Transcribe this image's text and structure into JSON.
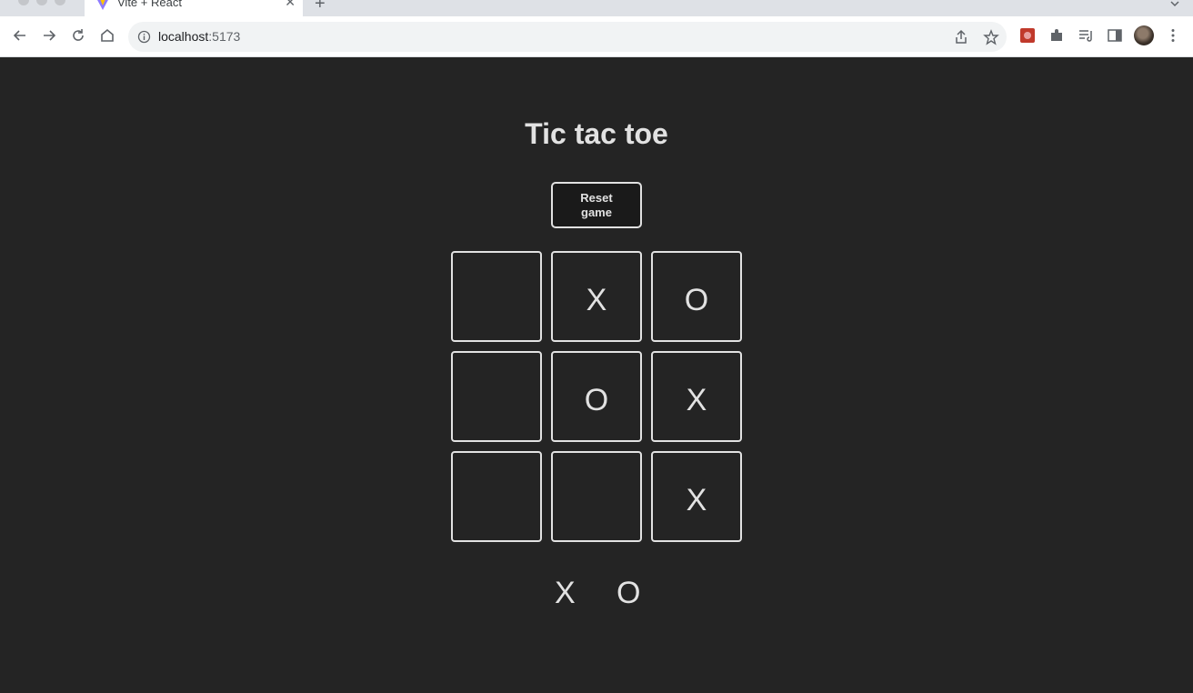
{
  "browser": {
    "tab_title": "Vite + React",
    "url_host": "localhost",
    "url_port": ":5173"
  },
  "game": {
    "title": "Tic tac toe",
    "reset_label": "Reset game",
    "board": [
      "",
      "X",
      "O",
      "",
      "O",
      "X",
      "",
      "",
      "X"
    ],
    "players": [
      "X",
      "O"
    ]
  },
  "colors": {
    "background": "#242424",
    "text": "#dedede",
    "chrome_tabstrip": "#dee1e6",
    "chrome_toolbar": "#ffffff"
  }
}
